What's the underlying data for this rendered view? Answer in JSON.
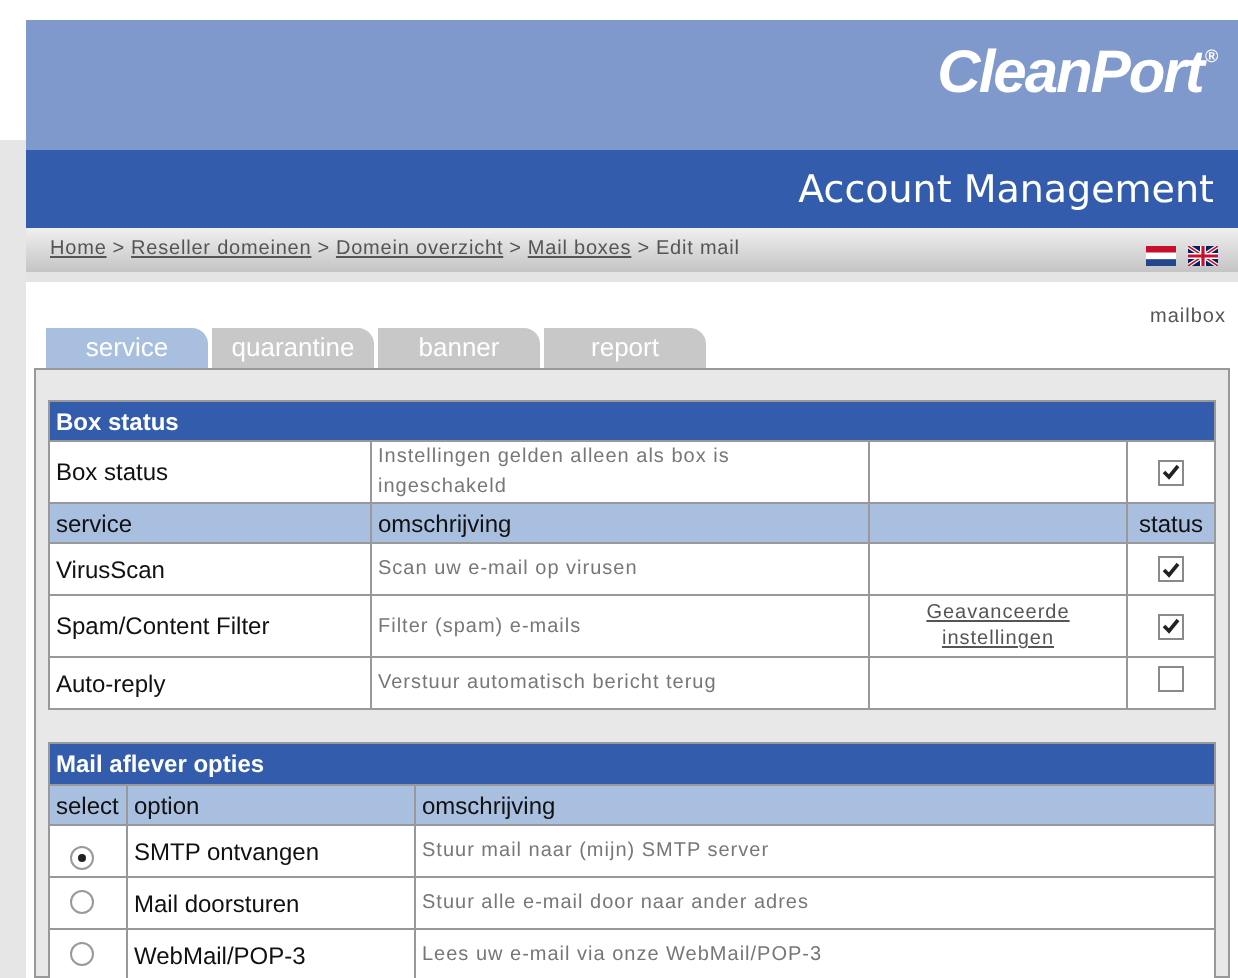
{
  "logo": {
    "text": "CleanPort",
    "mark": "®"
  },
  "header": {
    "title": "Account Management"
  },
  "breadcrumb": {
    "links": [
      "Home",
      "Reseller domeinen",
      "Domein overzicht",
      "Mail boxes"
    ],
    "separator": ">",
    "current": "Edit mail"
  },
  "languages": [
    {
      "kind": "dutch"
    },
    {
      "kind": "english"
    }
  ],
  "section_label": "mailbox",
  "tabs": [
    {
      "label": "service",
      "selected": true
    },
    {
      "label": "quarantine",
      "selected": false
    },
    {
      "label": "banner",
      "selected": false
    },
    {
      "label": "report",
      "selected": false
    }
  ],
  "box_status": {
    "title": "Box status",
    "row": {
      "name": "Box status",
      "description": "Instellingen gelden alleen als box is ingeschakeld",
      "checked": true
    },
    "columns": [
      "service",
      "omschrijving",
      "status"
    ],
    "services": [
      {
        "name": "VirusScan",
        "description": "Scan uw e-mail op virusen",
        "checked": true
      },
      {
        "name": "Spam/Content Filter",
        "description": "Filter (spam) e-mails",
        "link": "Geavanceerde instellingen",
        "checked": true
      },
      {
        "name": "Auto-reply",
        "description": "Verstuur automatisch bericht terug",
        "checked": false
      }
    ]
  },
  "delivery": {
    "title": "Mail aflever opties",
    "columns": [
      "select",
      "option",
      "omschrijving"
    ],
    "options": [
      {
        "name": "SMTP ontvangen",
        "description": "Stuur mail naar (mijn) SMTP server",
        "selected": true
      },
      {
        "name": "Mail doorsturen",
        "description": "Stuur alle e-mail door naar ander adres",
        "selected": false
      },
      {
        "name": "WebMail/POP-3",
        "description": "Lees uw e-mail via onze WebMail/POP-3",
        "selected": false
      }
    ]
  }
}
